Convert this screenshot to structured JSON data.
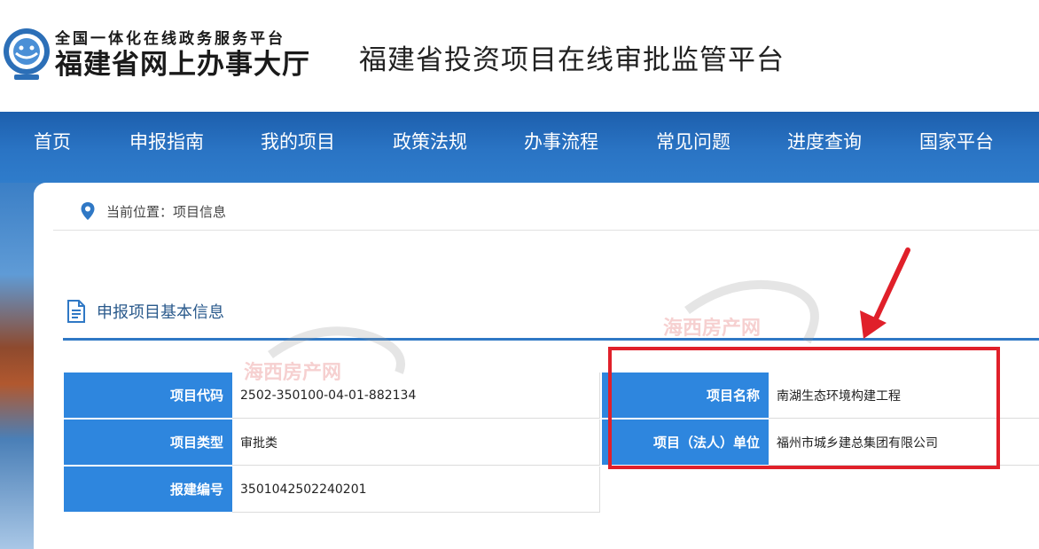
{
  "header": {
    "brand_top": "全国一体化在线政务服务平台",
    "brand_main": "福建省网上办事大厅",
    "platform_title": "福建省投资项目在线审批监管平台"
  },
  "nav": {
    "items": [
      "首页",
      "申报指南",
      "我的项目",
      "政策法规",
      "办事流程",
      "常见问题",
      "进度查询",
      "国家平台"
    ]
  },
  "breadcrumb": {
    "text": "当前位置：项目信息"
  },
  "section": {
    "title": "申报项目基本信息"
  },
  "left_table": [
    {
      "label": "项目代码",
      "value": "2502-350100-04-01-882134"
    },
    {
      "label": "项目类型",
      "value": "审批类"
    },
    {
      "label": "报建编号",
      "value": "3501042502240201"
    }
  ],
  "right_table": [
    {
      "label": "项目名称",
      "value": "南湖生态环境构建工程"
    },
    {
      "label": "项目（法人）单位",
      "value": "福州市城乡建总集团有限公司"
    }
  ],
  "watermark": {
    "text": "海西房产网"
  },
  "colors": {
    "nav_blue": "#2a74c4",
    "label_blue": "#2e86de",
    "highlight_red": "#e0202a"
  }
}
